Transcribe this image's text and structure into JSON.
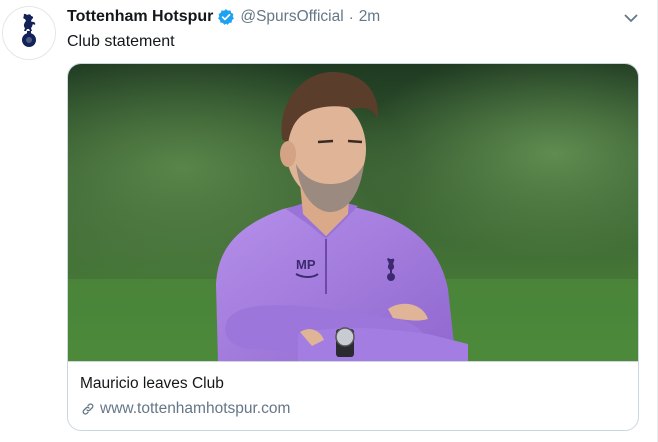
{
  "tweet": {
    "display_name": "Tottenham Hotspur",
    "handle": "@SpursOfficial",
    "separator": "·",
    "time": "2m",
    "text": "Club statement",
    "verified": true
  },
  "card": {
    "title": "Mauricio leaves Club",
    "url": "www.tottenhamhotspur.com",
    "image_subject": "man in purple training top with arms crossed",
    "shirt_initials": "MP"
  },
  "icons": {
    "avatar": "tottenham-cockerel-logo",
    "verified": "verified-badge-icon",
    "caret": "chevron-down-icon",
    "link": "link-icon"
  },
  "colors": {
    "verified_blue": "#1da1f2",
    "muted_text": "#657786",
    "shirt_purple": "#a77fe0"
  }
}
